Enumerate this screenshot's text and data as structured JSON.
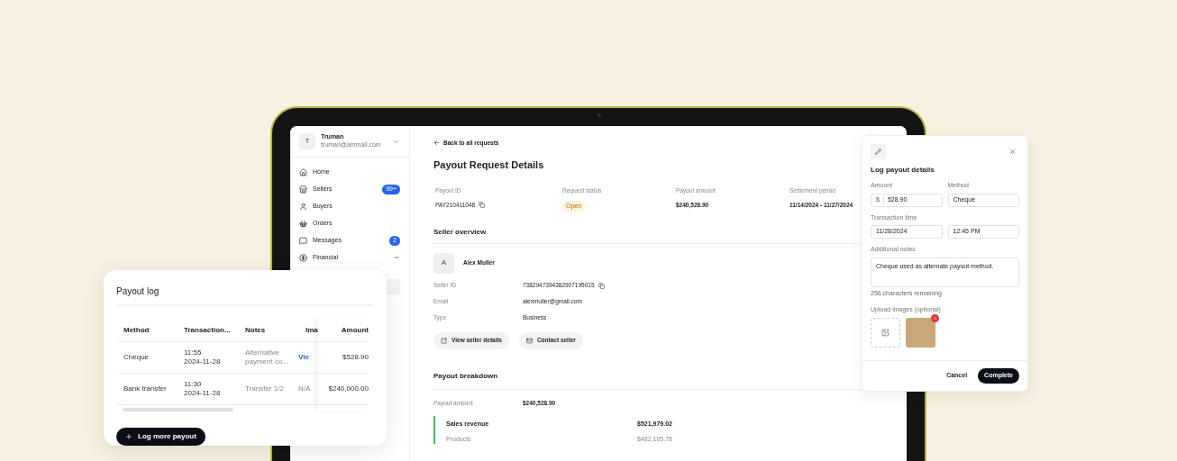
{
  "sidebar": {
    "user": {
      "initial": "T",
      "name": "Truman",
      "email": "truman@ammall.com"
    },
    "items": [
      {
        "label": "Home"
      },
      {
        "label": "Sellers",
        "badge": "99+"
      },
      {
        "label": "Buyers"
      },
      {
        "label": "Orders"
      },
      {
        "label": "Messages",
        "badge": "2"
      },
      {
        "label": "Financial",
        "expanded": true
      }
    ]
  },
  "main": {
    "back_link": "Back to all requests",
    "title": "Payout Request Details",
    "summary": [
      {
        "label": "Payout ID",
        "value": "PAY210411048",
        "kind": "copy"
      },
      {
        "label": "Request status",
        "value": "Open",
        "kind": "badge"
      },
      {
        "label": "Payout amount",
        "value": "$240,528.90",
        "kind": "text"
      },
      {
        "label": "Settlement period",
        "value": "11/14/2024 - 11/27/2024",
        "kind": "text"
      }
    ],
    "seller_overview": {
      "heading": "Seller overview",
      "avatar": "A",
      "name": "Alex Muller",
      "fields": [
        {
          "label": "Seller ID",
          "value": "7382947394382907195015",
          "kind": "copy"
        },
        {
          "label": "Email",
          "value": "alexmuller@gmail.com",
          "kind": "text"
        },
        {
          "label": "Type",
          "value": "Business",
          "kind": "text"
        }
      ],
      "buttons": [
        "View seller details",
        "Contact seller"
      ]
    },
    "payout_breakdown": {
      "heading": "Payout breakdown",
      "amount_label": "Payout amount",
      "amount": "$240,528.90",
      "lines": [
        {
          "label": "Sales revenue",
          "value": "$521,979.02",
          "kind": "total"
        },
        {
          "label": "Products",
          "value": "$482,105.78",
          "kind": "sub"
        }
      ]
    }
  },
  "log_dialog": {
    "title": "Log payout details",
    "amount_label": "Amount",
    "currency": "$",
    "amount": "528.90",
    "method_label": "Method",
    "method": "Cheque",
    "time_label": "Transaction time",
    "date": "11/28/2024",
    "time": "12:45 PM",
    "notes_label": "Additional notes",
    "notes": "Cheque used as alternate payout method.",
    "remaining": "256 characters remaining",
    "upload_label": "Upload images (optional)",
    "buttons": [
      "Cancel",
      "Complete"
    ]
  },
  "payout_log": {
    "title": "Payout log",
    "columns": [
      "Method",
      "Transaction...",
      "Notes",
      "Ima",
      "Amount"
    ],
    "rows": [
      {
        "method": "Cheque",
        "time": "11:55",
        "date": "2024-11-28",
        "notes": "Alternative payment co...",
        "image": "Vie",
        "image_link": true,
        "amount": "$528.90"
      },
      {
        "method": "Bank transfer",
        "time": "11:30",
        "date": "2024-11-28",
        "notes": "Transfer 1/2",
        "image": "N/A",
        "image_link": false,
        "amount": "$240,000.00"
      }
    ],
    "button": "Log more payout"
  }
}
